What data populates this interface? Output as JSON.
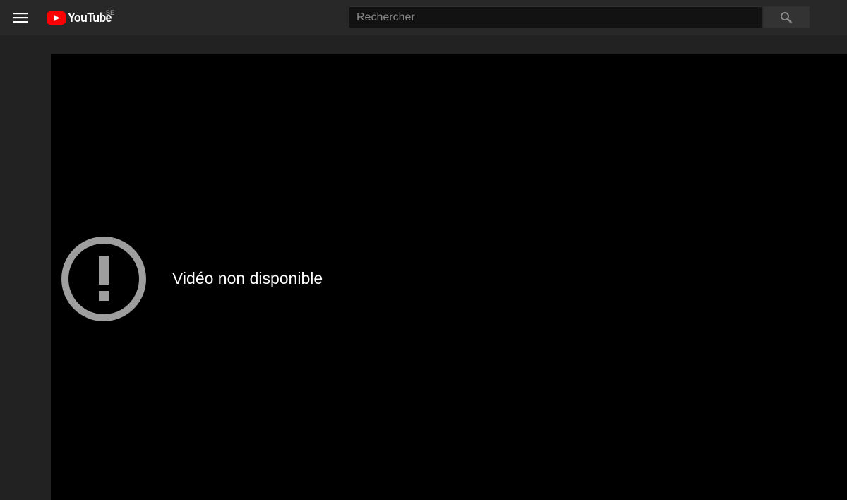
{
  "header": {
    "logo_text": "YouTube",
    "country_code": "BE",
    "brand_color": "#ff0000",
    "menu_icon": "hamburger-menu-icon",
    "search": {
      "placeholder": "Rechercher",
      "value": "",
      "button_icon": "search-icon"
    }
  },
  "player": {
    "error_icon": "alert-circle-icon",
    "error_message": "Vidéo non disponible"
  }
}
